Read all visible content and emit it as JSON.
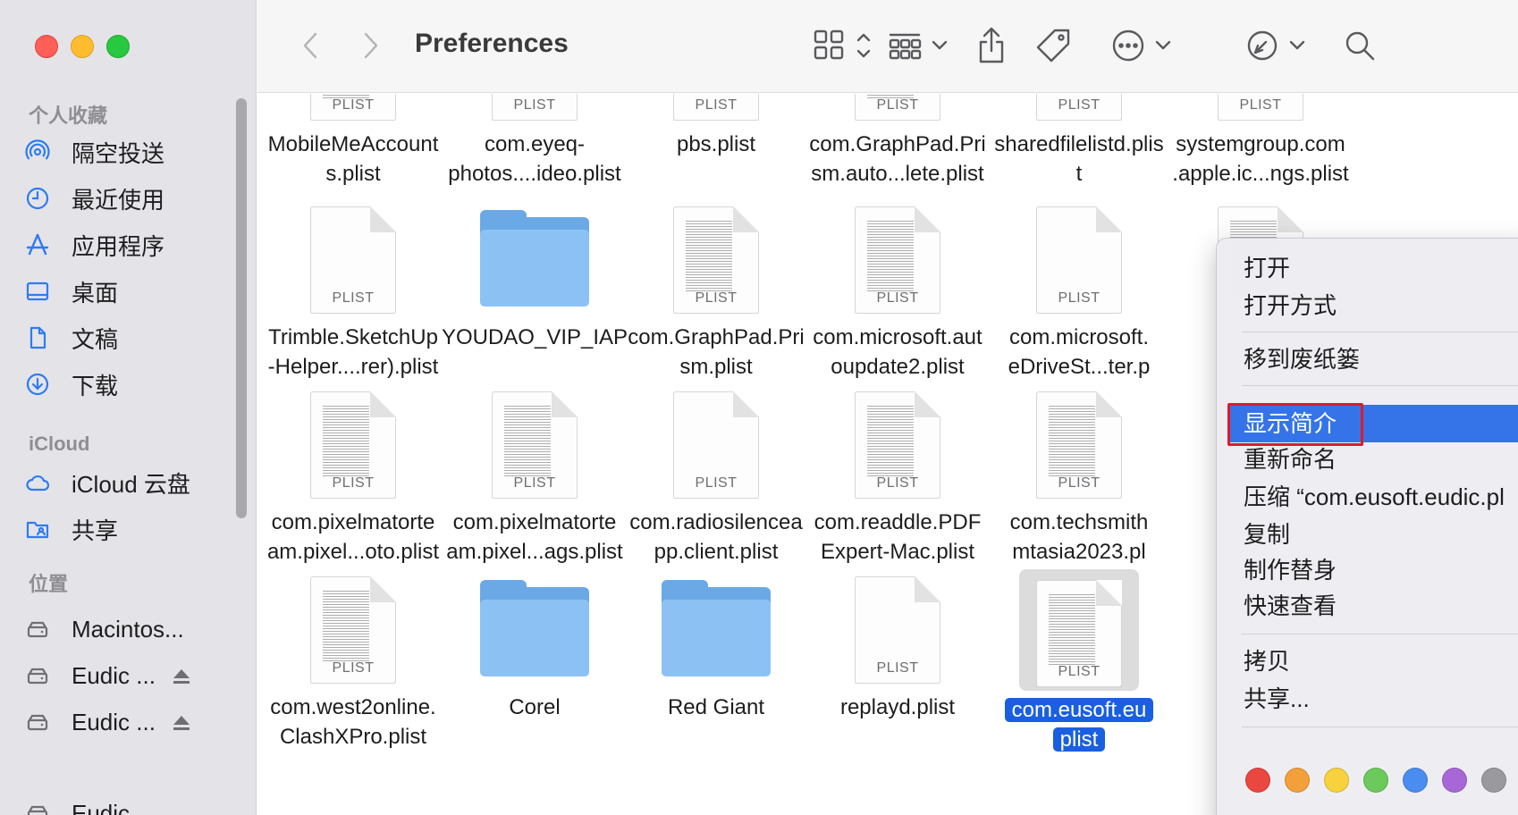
{
  "window": {
    "title": "Preferences"
  },
  "sidebar": {
    "sections": {
      "favorites": "个人收藏",
      "icloud": "iCloud",
      "locations": "位置"
    },
    "favorites": [
      {
        "label": "隔空投送",
        "icon": "airdrop-icon"
      },
      {
        "label": "最近使用",
        "icon": "clock-icon"
      },
      {
        "label": "应用程序",
        "icon": "applications-icon"
      },
      {
        "label": "桌面",
        "icon": "desktop-icon"
      },
      {
        "label": "文稿",
        "icon": "document-icon"
      },
      {
        "label": "下载",
        "icon": "download-icon"
      }
    ],
    "icloud_items": [
      {
        "label": "iCloud 云盘",
        "icon": "cloud-icon"
      },
      {
        "label": "共享",
        "icon": "shared-folder-icon"
      }
    ],
    "locations": [
      {
        "label": "Macintos...",
        "icon": "disk-icon"
      },
      {
        "label": "Eudic ...",
        "icon": "disk-icon",
        "ejectable": true
      },
      {
        "label": "Eudic ...",
        "icon": "disk-icon",
        "ejectable": true
      },
      {
        "label": "Eudic",
        "icon": "disk-icon",
        "ejectable": true
      }
    ]
  },
  "toolbar": {
    "back": "chevron-left-icon",
    "forward": "chevron-right-icon",
    "view": "icon-grid-icon",
    "group": "group-icon",
    "share": "share-icon",
    "tag": "tag-icon",
    "more": "ellipsis-circle-icon",
    "markup": "markup-icon",
    "search": "search-icon"
  },
  "files": [
    {
      "name": "MobileMeAccount s.plist",
      "type": "PLIST",
      "kind": "file"
    },
    {
      "name": "com.eyeq-photos....ideo.plist",
      "type": "PLIST",
      "kind": "file"
    },
    {
      "name": "pbs.plist",
      "type": "PLIST",
      "kind": "file"
    },
    {
      "name": "com.GraphPad.Prism.auto...lete.plist",
      "type": "PLIST",
      "kind": "file"
    },
    {
      "name": "sharedfilelistd.plist",
      "type": "PLIST",
      "kind": "file"
    },
    {
      "name": "systemgroup.com.apple.ic...ngs.plist",
      "type": "PLIST",
      "kind": "file"
    },
    {
      "name": "Trimble.SketchUp-Helper....rer).plist",
      "type": "PLIST",
      "kind": "file"
    },
    {
      "name": "YOUDAO_VIP_IAP",
      "type": "",
      "kind": "folder"
    },
    {
      "name": "com.GraphPad.Prism.plist",
      "type": "PLIST",
      "kind": "file"
    },
    {
      "name": "com.microsoft.autoupdate2.plist",
      "type": "PLIST",
      "kind": "file"
    },
    {
      "name": "com.microsoft. eDriveSt...ter.p",
      "type": "PLIST",
      "kind": "file"
    },
    {
      "name": "",
      "type": "",
      "kind": "file"
    },
    {
      "name": "com.pixelmatorteam.pixel...oto.plist",
      "type": "PLIST",
      "kind": "file"
    },
    {
      "name": "com.pixelmatorteam.pixel...ags.plist",
      "type": "PLIST",
      "kind": "file"
    },
    {
      "name": "com.radiosilenceapp.client.plist",
      "type": "PLIST",
      "kind": "file"
    },
    {
      "name": "com.readdle.PDFExpert-Mac.plist",
      "type": "PLIST",
      "kind": "file"
    },
    {
      "name": "com.techsmith mtasia2023.pl",
      "type": "PLIST",
      "kind": "file"
    },
    {
      "name": "com.west2online.ClashXPro.plist",
      "type": "PLIST",
      "kind": "file"
    },
    {
      "name": "Corel",
      "type": "",
      "kind": "folder"
    },
    {
      "name": "Red Giant",
      "type": "",
      "kind": "folder"
    },
    {
      "name": "replayd.plist",
      "type": "PLIST",
      "kind": "file"
    },
    {
      "name": "com.eusoft.eu plist",
      "type": "PLIST",
      "kind": "file",
      "selected": true
    }
  ],
  "file_name_lines": {
    "r0": [
      [
        "MobileMeAccount",
        "s.plist"
      ],
      [
        "com.eyeq-",
        "photos....ideo.plist"
      ],
      [
        "pbs.plist"
      ],
      [
        "com.GraphPad.Pri",
        "sm.auto...lete.plist"
      ],
      [
        "sharedfilelistd.plis",
        "t"
      ],
      [
        "systemgroup.com",
        ".apple.ic...ngs.plist"
      ]
    ],
    "r1": [
      [
        "Trimble.SketchUp",
        "-Helper....rer).plist"
      ],
      [
        "YOUDAO_VIP_IAP"
      ],
      [
        "com.GraphPad.Pri",
        "sm.plist"
      ],
      [
        "com.microsoft.aut",
        "oupdate2.plist"
      ],
      [
        "com.microsoft.",
        "eDriveSt...ter.p"
      ]
    ],
    "r2": [
      [
        "com.pixelmatorte",
        "am.pixel...oto.plist"
      ],
      [
        "com.pixelmatorte",
        "am.pixel...ags.plist"
      ],
      [
        "com.radiosilencea",
        "pp.client.plist"
      ],
      [
        "com.readdle.PDF",
        "Expert-Mac.plist"
      ],
      [
        "com.techsmith",
        "mtasia2023.pl"
      ]
    ],
    "r3": [
      [
        "com.west2online.",
        "ClashXPro.plist"
      ],
      [
        "Corel"
      ],
      [
        "Red Giant"
      ],
      [
        "replayd.plist"
      ],
      [
        "com.eusoft.eu",
        "plist"
      ]
    ]
  },
  "context_menu": {
    "items": [
      {
        "label": "打开"
      },
      {
        "label": "打开方式"
      },
      {
        "label": "移到废纸篓"
      },
      {
        "label": "显示简介",
        "highlighted": true,
        "annotated": true
      },
      {
        "label": "重新命名"
      },
      {
        "label": "压缩 “com.eusoft.eudic.pl"
      },
      {
        "label": "复制"
      },
      {
        "label": "制作替身"
      },
      {
        "label": "快速查看"
      },
      {
        "label": "拷贝"
      },
      {
        "label": "共享..."
      }
    ],
    "tag_colors": [
      "#e9473f",
      "#f3a03a",
      "#f7d23e",
      "#6cc95c",
      "#4a8df0",
      "#a867d6",
      "#9a9a9e"
    ]
  },
  "colors": {
    "selection": "#1a5fe0",
    "menu_highlight": "#3574e8",
    "annotation": "#e0192a",
    "folder": "#8cc2f3"
  }
}
